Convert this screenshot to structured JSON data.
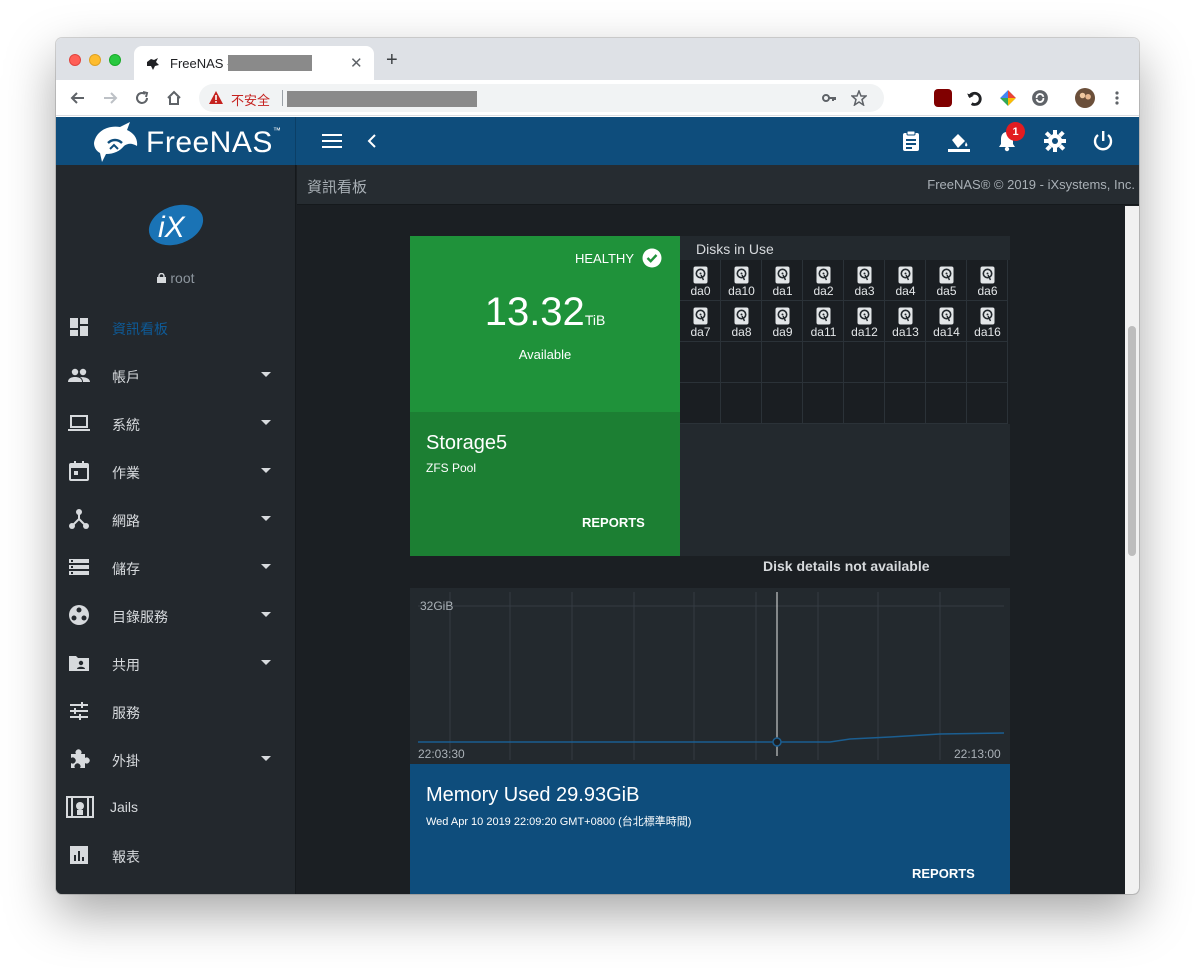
{
  "browser": {
    "tab_title": "FreeNAS - ",
    "security_label": "不安全",
    "new_tab_glyph": "+",
    "close_glyph": "✕"
  },
  "app": {
    "brand": "FreeNAS",
    "brand_tm": "™",
    "notification_count": "1",
    "user": "root",
    "page_title": "資訊看板",
    "copyright": "FreeNAS® © 2019 - iXsystems, Inc."
  },
  "sidebar": {
    "items": [
      {
        "label": "資訊看板",
        "icon": "dashboard-icon"
      },
      {
        "label": "帳戶",
        "icon": "people-icon"
      },
      {
        "label": "系統",
        "icon": "laptop-icon"
      },
      {
        "label": "作業",
        "icon": "calendar-icon"
      },
      {
        "label": "網路",
        "icon": "network-icon"
      },
      {
        "label": "儲存",
        "icon": "storage-icon"
      },
      {
        "label": "目錄服務",
        "icon": "directory-icon"
      },
      {
        "label": "共用",
        "icon": "shared-folder-icon"
      },
      {
        "label": "服務",
        "icon": "tune-icon"
      },
      {
        "label": "外掛",
        "icon": "puzzle-icon"
      },
      {
        "label": "Jails",
        "icon": "jail-icon"
      },
      {
        "label": "報表",
        "icon": "chart-icon"
      }
    ]
  },
  "pool": {
    "status": "HEALTHY",
    "available_value": "13.32",
    "available_unit": "TiB",
    "available_label": "Available",
    "name": "Storage5",
    "type": "ZFS Pool",
    "reports_label": "REPORTS",
    "disks_title": "Disks in Use",
    "disks": [
      "da0",
      "da10",
      "da1",
      "da2",
      "da3",
      "da4",
      "da5",
      "da6",
      "da7",
      "da8",
      "da9",
      "da11",
      "da12",
      "da13",
      "da14",
      "da16"
    ],
    "disk_note": "Disk details not available"
  },
  "memory": {
    "title": "Memory Used 29.93GiB",
    "timestamp": "Wed Apr 10 2019 22:09:20 GMT+0800 (台北標準時間)",
    "reports_label": "REPORTS",
    "chart_ylabel_top": "32GiB",
    "chart_x_start": "22:03:30",
    "chart_x_end": "22:13:00"
  },
  "colors": {
    "topbar": "#0e4d7c",
    "pool_green": "#1f923a",
    "sidebar": "#23282d",
    "accent_blue": "#0e5a96"
  }
}
